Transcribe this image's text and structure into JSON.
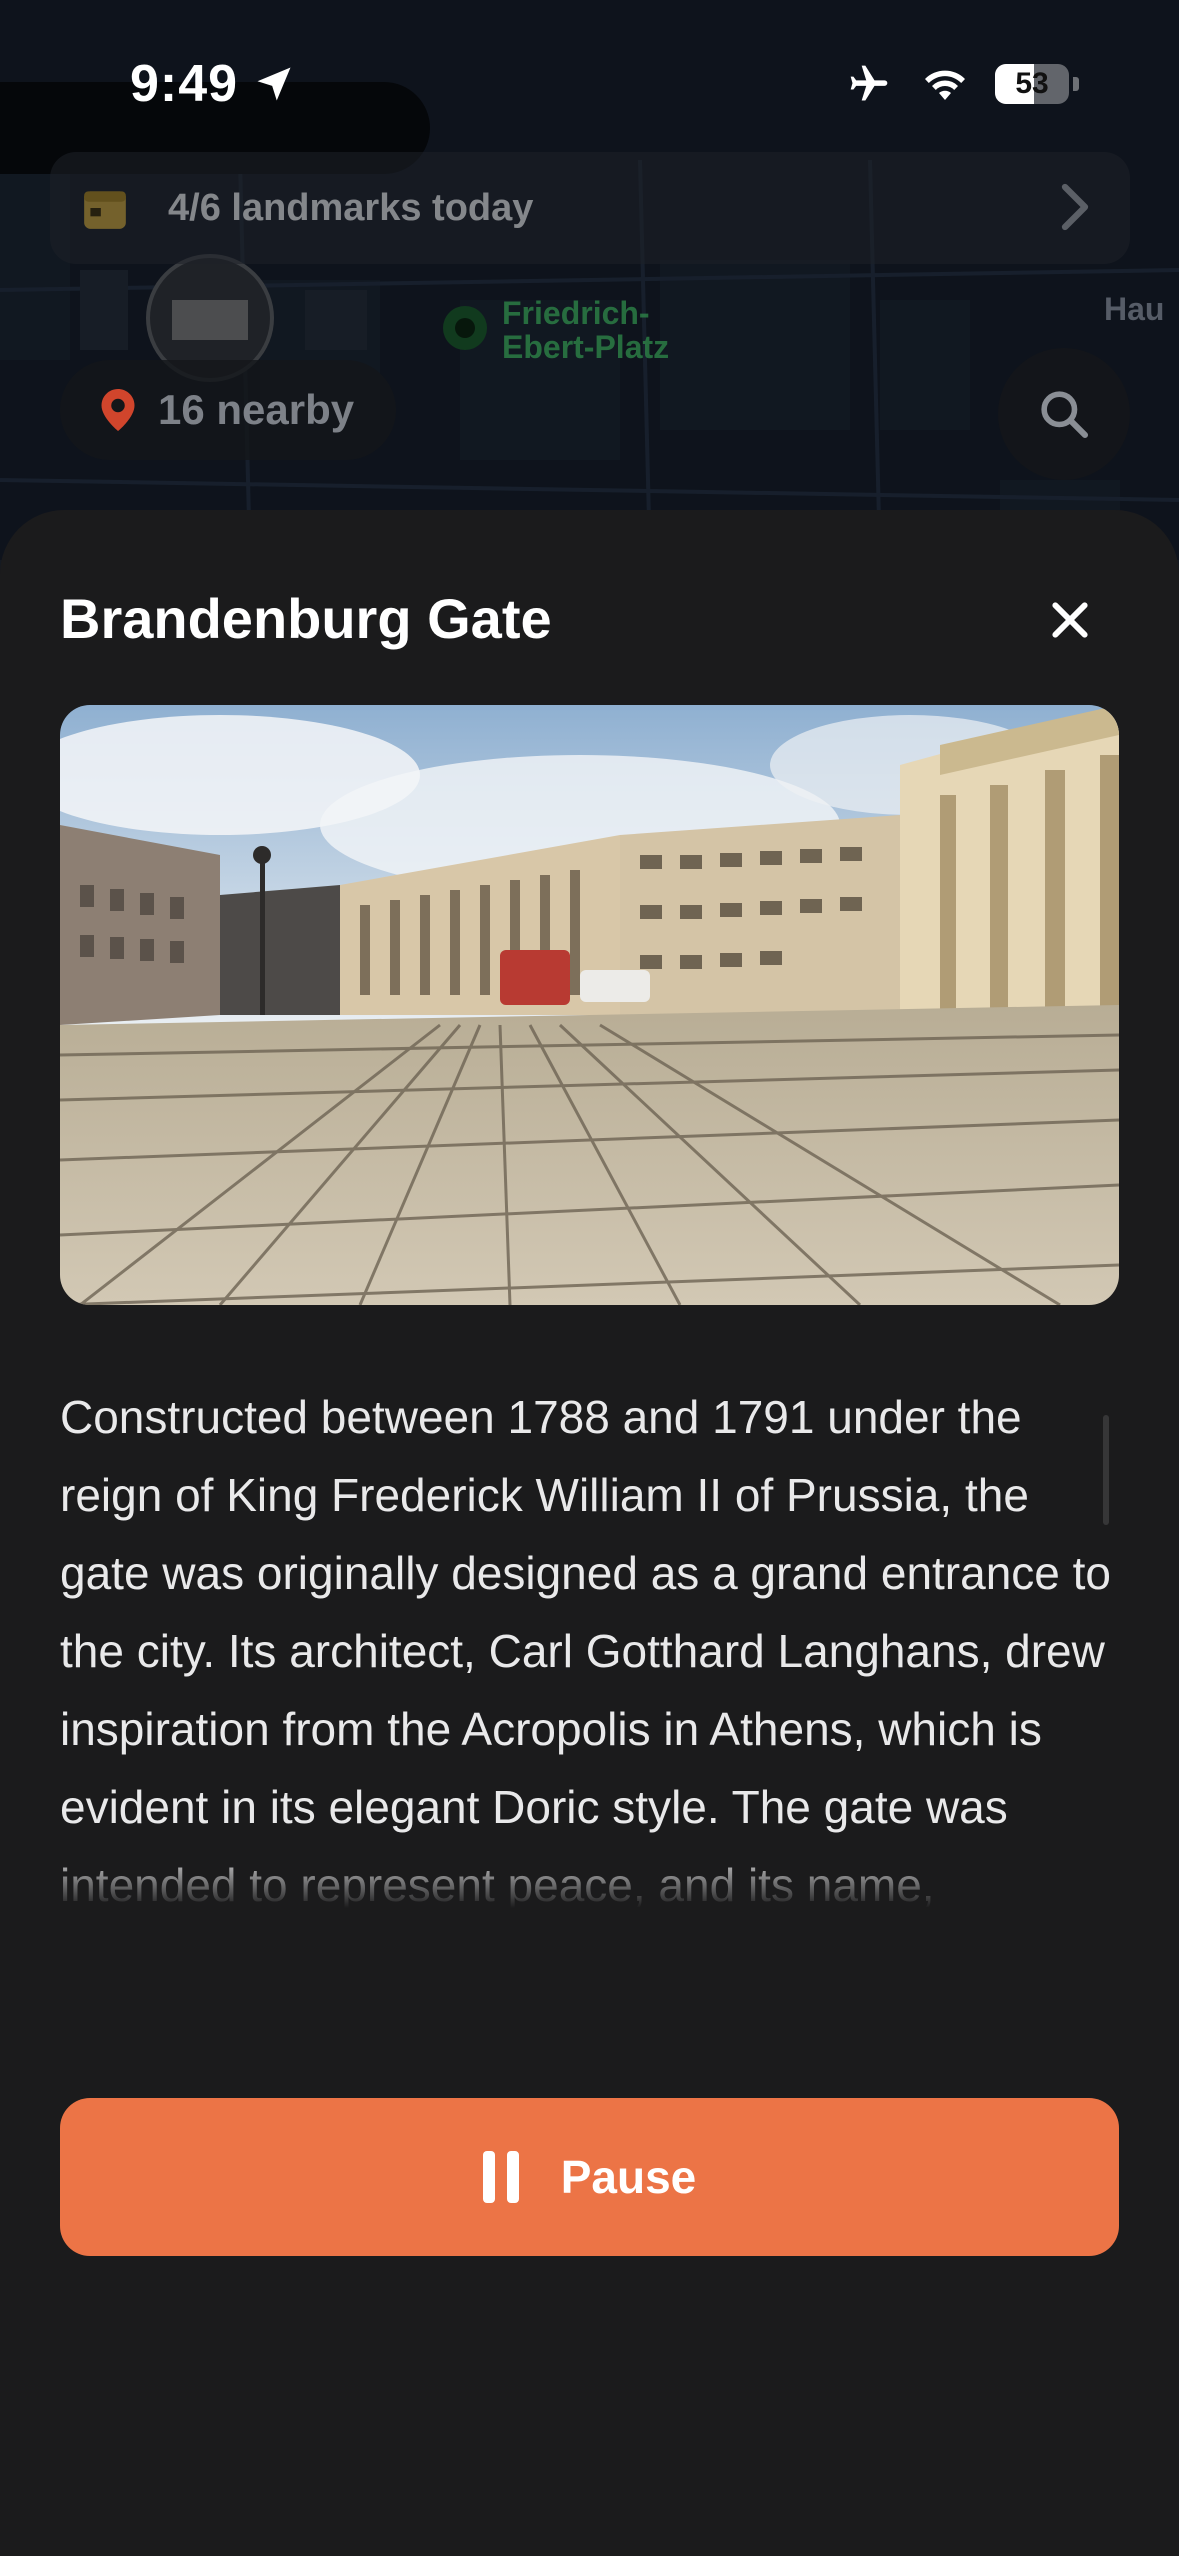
{
  "status_bar": {
    "time": "9:49",
    "battery_level": "53",
    "battery_fraction": 0.53,
    "icons": [
      "location-arrow-icon",
      "airplane-icon",
      "wifi-icon",
      "battery-icon"
    ]
  },
  "map": {
    "landmarks_banner": "4/6 landmarks today",
    "nearby_label": "16 nearby",
    "place_label_line1": "Friedrich-",
    "place_label_line2": "Ebert-Platz",
    "edge_label": "Hau"
  },
  "sheet": {
    "title": "Brandenburg Gate",
    "description": "Constructed between 1788 and 1791 under the reign of King Frederick William II of Prussia, the gate was originally designed as a grand entrance to the city. Its architect, Carl Gotthard Langhans, drew inspiration from the Acropolis in Athens, which is evident in its elegant Doric style. The gate was intended to represent peace, and its name, “Brandenburg Tor,” reflects its position as a gateway to the province of",
    "pause_label": "Pause"
  },
  "colors": {
    "accent": "#ec7446",
    "sheet_bg": "#1b1b1c",
    "title_text": "#ffffff",
    "body_text": "#e9e9ea"
  }
}
